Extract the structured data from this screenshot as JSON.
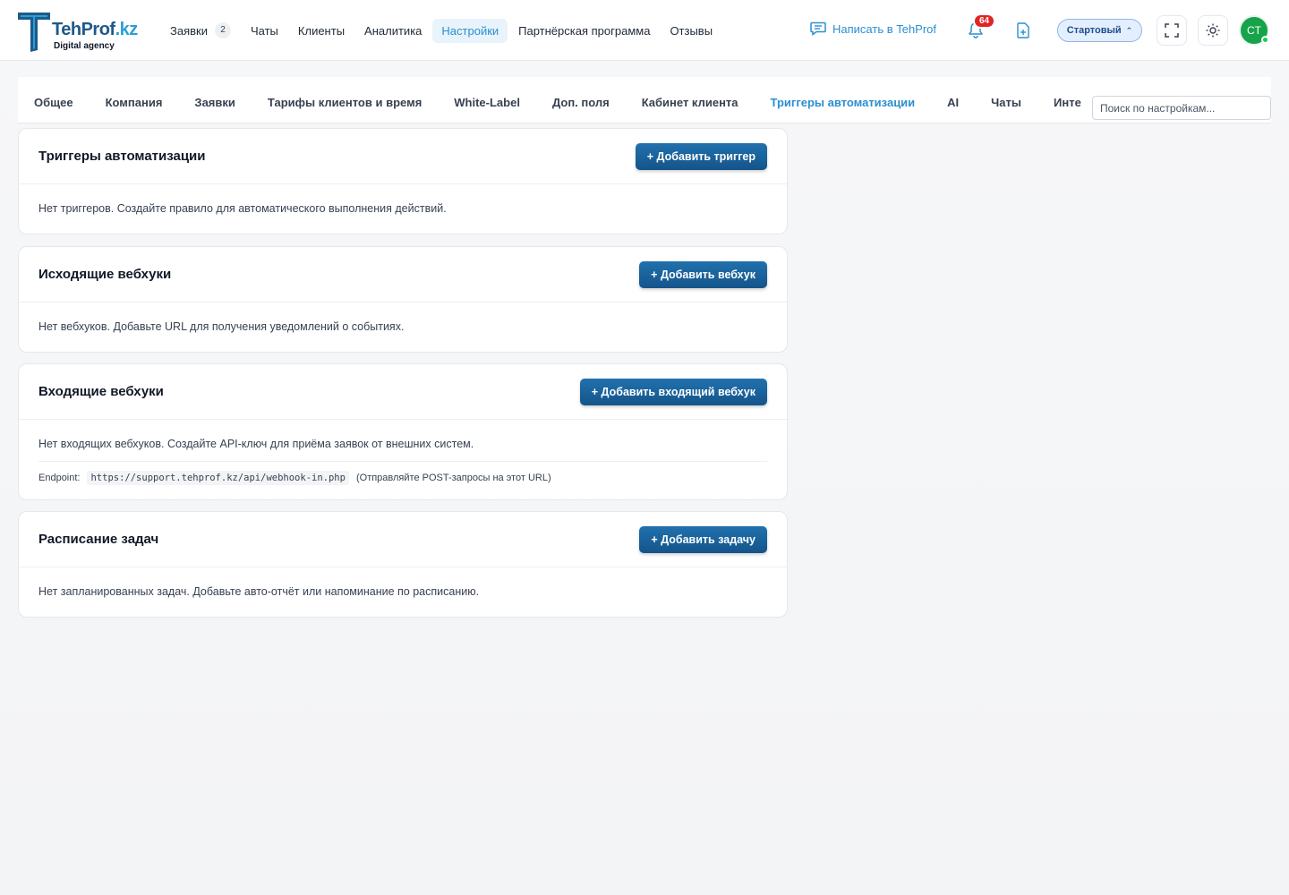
{
  "brand": {
    "name_main": "TehProf",
    "name_tld": ".kz",
    "tagline": "Digital agency",
    "color_primary": "#1e5a8a",
    "color_accent": "#2a9fd6"
  },
  "nav": {
    "items": [
      {
        "label": "Заявки",
        "badge": "2"
      },
      {
        "label": "Чаты"
      },
      {
        "label": "Клиенты"
      },
      {
        "label": "Аналитика"
      },
      {
        "label": "Настройки",
        "active": true
      },
      {
        "label": "Партнёрская программа"
      },
      {
        "label": "Отзывы"
      }
    ]
  },
  "header": {
    "write_label": "Написать в TehProf",
    "notifications_count": "64",
    "plan_label": "Стартовый",
    "avatar_initials": "CT",
    "icons": [
      "chat-icon",
      "bell-icon",
      "add-document-icon",
      "fullscreen-icon",
      "sun-icon"
    ]
  },
  "tabs": {
    "items": [
      "Общее",
      "Компания",
      "Заявки",
      "Тарифы клиентов и время",
      "White-Label",
      "Доп. поля",
      "Кабинет клиента",
      "Триггеры автоматизации",
      "AI",
      "Чаты",
      "Инте"
    ],
    "active_index": 7,
    "search_placeholder": "Поиск по настройкам..."
  },
  "cards": {
    "triggers": {
      "title": "Триггеры автоматизации",
      "button": "+ Добавить триггер",
      "empty_text": "Нет триггеров. Создайте правило для автоматического выполнения действий."
    },
    "outgoing": {
      "title": "Исходящие вебхуки",
      "button": "+ Добавить вебхук",
      "empty_text": "Нет вебхуков. Добавьте URL для получения уведомлений о событиях."
    },
    "incoming": {
      "title": "Входящие вебхуки",
      "button": "+ Добавить входящий вебхук",
      "empty_text": "Нет входящих вебхуков. Создайте API-ключ для приёма заявок от внешних систем.",
      "endpoint_label": "Endpoint:",
      "endpoint_url": "https://support.tehprof.kz/api/webhook-in.php",
      "endpoint_hint": "(Отправляйте POST-запросы на этот URL)"
    },
    "schedule": {
      "title": "Расписание задач",
      "button": "+ Добавить задачу",
      "empty_text": "Нет запланированных задач. Добавьте авто-отчёт или напоминание по расписанию."
    }
  }
}
